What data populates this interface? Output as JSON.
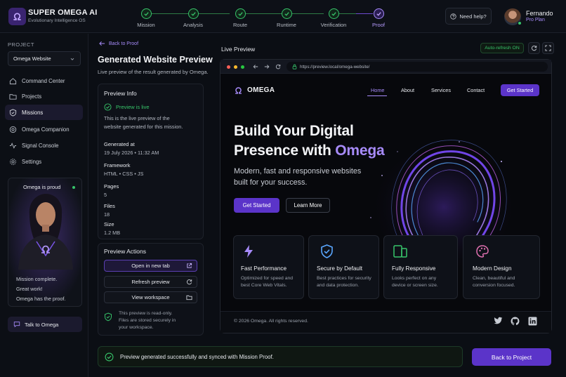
{
  "app": {
    "title": "SUPER OMEGA AI",
    "subtitle": "Evolutionary Intelligence OS"
  },
  "steps": [
    {
      "label": "Mission",
      "state": "done"
    },
    {
      "label": "Analysis",
      "state": "done"
    },
    {
      "label": "Route",
      "state": "done"
    },
    {
      "label": "Runtime",
      "state": "done"
    },
    {
      "label": "Verification",
      "state": "done"
    },
    {
      "label": "Proof",
      "state": "active"
    }
  ],
  "header": {
    "help_label": "Need help?",
    "user_name": "Fernando",
    "user_plan": "Pro Plan"
  },
  "sidebar": {
    "project_label": "PROJECT",
    "project_value": "Omega Website",
    "items": [
      {
        "label": "Command Center",
        "icon": "command-icon"
      },
      {
        "label": "Projects",
        "icon": "folder-icon"
      },
      {
        "label": "Missions",
        "icon": "shield-icon",
        "active": true
      },
      {
        "label": "Omega Companion",
        "icon": "companion-icon"
      },
      {
        "label": "Signal Console",
        "icon": "signal-icon"
      },
      {
        "label": "Settings",
        "icon": "gear-icon"
      }
    ],
    "companion": {
      "title": "Omega is proud",
      "lines": [
        "Mission complete.",
        "Great work!",
        "Omega has the proof."
      ]
    },
    "talk_label": "Talk to Omega"
  },
  "main": {
    "back_label": "Back to Proof",
    "title": "Generated Website Preview",
    "subtitle": "Live preview of the result generated by Omega.",
    "info": {
      "title": "Preview Info",
      "live_status": "Preview is live",
      "description_lines": [
        "This is the live preview of the",
        "website generated for this mission."
      ],
      "fields": [
        {
          "label": "Generated at",
          "value": "19 July 2026 • 11:32 AM"
        },
        {
          "label": "Framework",
          "value": "HTML • CSS • JS"
        },
        {
          "label": "Pages",
          "value": "5"
        },
        {
          "label": "Files",
          "value": "18"
        },
        {
          "label": "Size",
          "value": "1.2 MB"
        }
      ]
    },
    "actions": {
      "title": "Preview Actions",
      "open_label": "Open in new tab",
      "refresh_label": "Refresh preview",
      "workspace_label": "View workspace",
      "readonly_lines": [
        "This preview is read-only.",
        "Files are stored securely in",
        "your workspace."
      ]
    },
    "status_message": "Preview generated successfully and synced with Mission Proof.",
    "back_project_label": "Back to Project"
  },
  "preview": {
    "label": "Live Preview",
    "auto_refresh": "Auto-refresh ON",
    "url": "https://preview.local/omega-website/",
    "site": {
      "logo": "OMEGA",
      "nav": [
        "Home",
        "About",
        "Services",
        "Contact"
      ],
      "cta": "Get Started",
      "hero_line1": "Build Your Digital",
      "hero_line2_pre": "Presence with ",
      "hero_line2_accent": "Omega",
      "hero_sub_line1": "Modern, fast and responsive websites",
      "hero_sub_line2": "built for your success.",
      "hero_primary": "Get Started",
      "hero_secondary": "Learn More",
      "features": [
        {
          "title": "Fast Performance",
          "desc_lines": [
            "Optimized for speed and",
            "best Core Web Vitals."
          ],
          "icon": "lightning-icon",
          "color": "#a78bfa"
        },
        {
          "title": "Secure by Default",
          "desc_lines": [
            "Best practices for security",
            "and data protection."
          ],
          "icon": "shield-check-icon",
          "color": "#5aa7ff"
        },
        {
          "title": "Fully Responsive",
          "desc_lines": [
            "Looks perfect on any",
            "device or screen size."
          ],
          "icon": "devices-icon",
          "color": "#37c56a"
        },
        {
          "title": "Modern Design",
          "desc_lines": [
            "Clean, beautiful and",
            "conversion focused."
          ],
          "icon": "palette-icon",
          "color": "#e070b0"
        }
      ],
      "copyright": "© 2026 Omega. All rights reserved."
    }
  },
  "colors": {
    "accent": "#5b34c9",
    "accent_light": "#a78bfa",
    "success": "#37c56a",
    "background": "#0b0e14"
  }
}
